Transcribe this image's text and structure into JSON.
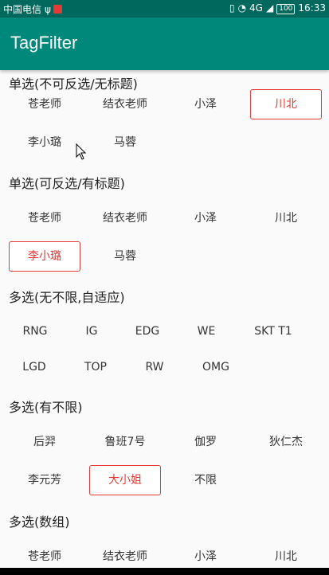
{
  "status_bar": {
    "carrier": "中国电信",
    "usb_icon": "usb-icon",
    "sim_alert_icon": "sim-alert-icon",
    "vibrate_icon": "vibrate-icon",
    "wifi_icon": "wifi-icon",
    "network": "4G",
    "battery": "100",
    "time": "16:33"
  },
  "app_bar": {
    "title": "TagFilter"
  },
  "sections": [
    {
      "title": "单选(不可反选/无标题)",
      "tags": [
        "苍老师",
        "结衣老师",
        "小泽",
        "川北",
        "李小璐",
        "马蓉"
      ],
      "selected": [
        "川北"
      ]
    },
    {
      "title": "单选(可反选/有标题)",
      "tags": [
        "苍老师",
        "结衣老师",
        "小泽",
        "川北",
        "李小璐",
        "马蓉"
      ],
      "selected": [
        "李小璐"
      ]
    },
    {
      "title": "多选(无不限,自适应)",
      "tags": [
        "RNG",
        "IG",
        "EDG",
        "WE",
        "SKT T1",
        "LGD",
        "TOP",
        "RW",
        "OMG"
      ],
      "selected": []
    },
    {
      "title": "多选(有不限)",
      "tags": [
        "后羿",
        "鲁班7号",
        "伽罗",
        "狄仁杰",
        "李元芳",
        "大小姐",
        "不限"
      ],
      "selected": [
        "大小姐"
      ]
    },
    {
      "title": "多选(数组)",
      "tags": [
        "苍老师",
        "结衣老师",
        "小泽",
        "川北"
      ],
      "selected": []
    }
  ],
  "colors": {
    "status_bar": "#00685c",
    "app_bar": "#00897b",
    "selected_accent": "#e53935"
  },
  "cursor_icon": "mouse-pointer-icon"
}
